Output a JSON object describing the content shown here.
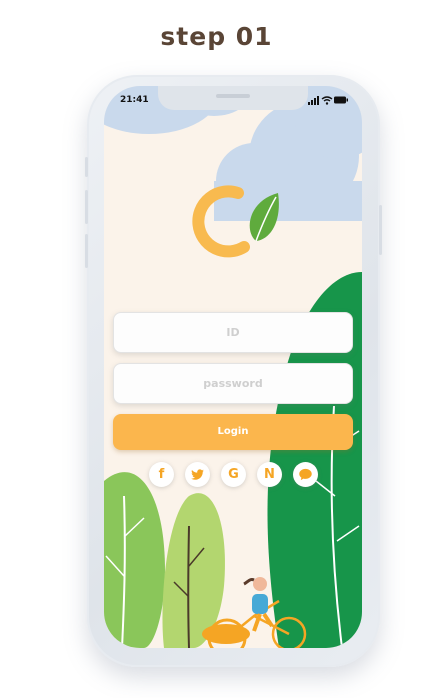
{
  "heading": {
    "step_label": "step 01"
  },
  "status_bar": {
    "time": "21:41",
    "icons": [
      "signal-icon",
      "wifi-icon",
      "battery-icon"
    ]
  },
  "app": {
    "logo": "leaf-c-logo-icon"
  },
  "login_form": {
    "id_placeholder": "ID",
    "password_placeholder": "password",
    "login_label": "Login"
  },
  "social_login": [
    {
      "name": "facebook",
      "glyph": "f"
    },
    {
      "name": "twitter",
      "glyph": ""
    },
    {
      "name": "google",
      "glyph": "G"
    },
    {
      "name": "naver",
      "glyph": "N"
    },
    {
      "name": "chat",
      "glyph": ""
    }
  ],
  "colors": {
    "accent": "#fbb64d",
    "background": "#fbf3ea",
    "cloud": "#c9d9ec",
    "leaf_green": "#17954a",
    "light_green": "#8ac65a",
    "title": "#5a4536"
  }
}
